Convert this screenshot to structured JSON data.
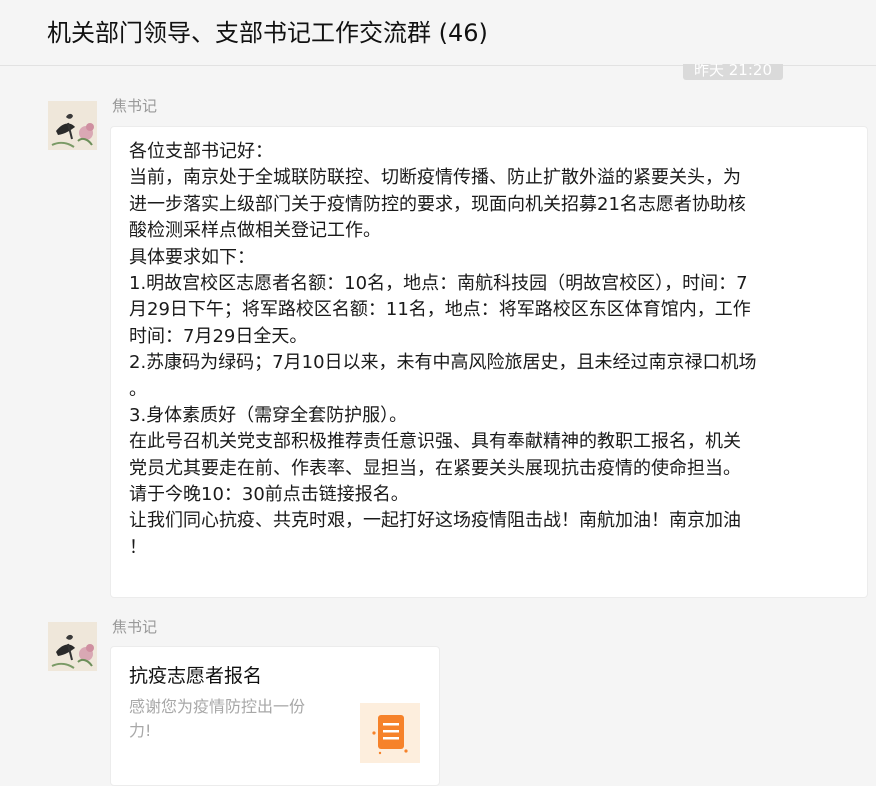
{
  "header": {
    "title": "机关部门领导、支部书记工作交流群 (46)"
  },
  "timestamp": "昨天 21:20",
  "messages": [
    {
      "sender": "焦书记",
      "lines": [
        "各位支部书记好：",
        "当前，南京处于全城联防联控、切断疫情传播、防止扩散外溢的紧要关头，为",
        "进一步落实上级部门关于疫情防控的要求，现面向机关招募21名志愿者协助核",
        "酸检测采样点做相关登记工作。",
        "具体要求如下：",
        "1.明故宫校区志愿者名额：10名，地点：南航科技园（明故宫校区），时间：7",
        "月29日下午；将军路校区名额：11名，地点：将军路校区东区体育馆内，工作",
        "时间：7月29日全天。",
        "2.苏康码为绿码；7月10日以来，未有中高风险旅居史，且未经过南京禄口机场",
        "。",
        "3.身体素质好（需穿全套防护服）。",
        "在此号召机关党支部积极推荐责任意识强、具有奉献精神的教职工报名，机关",
        "党员尤其要走在前、作表率、显担当，在紧要关头展现抗击疫情的使命担当。",
        "请于今晚10：30前点击链接报名。",
        "让我们同心抗疫、共克时艰，一起打好这场疫情阻击战！南航加油！南京加油",
        "！"
      ]
    },
    {
      "sender": "焦书记",
      "card": {
        "title": "抗疫志愿者报名",
        "desc_lines": [
          "感谢您为疫情防控出一份",
          "力!"
        ],
        "icon": "form-document-icon"
      }
    }
  ],
  "colors": {
    "background": "#f5f5f5",
    "bubble": "#ffffff",
    "icon_orange": "#f6822a",
    "icon_bg": "#fdeedd"
  }
}
